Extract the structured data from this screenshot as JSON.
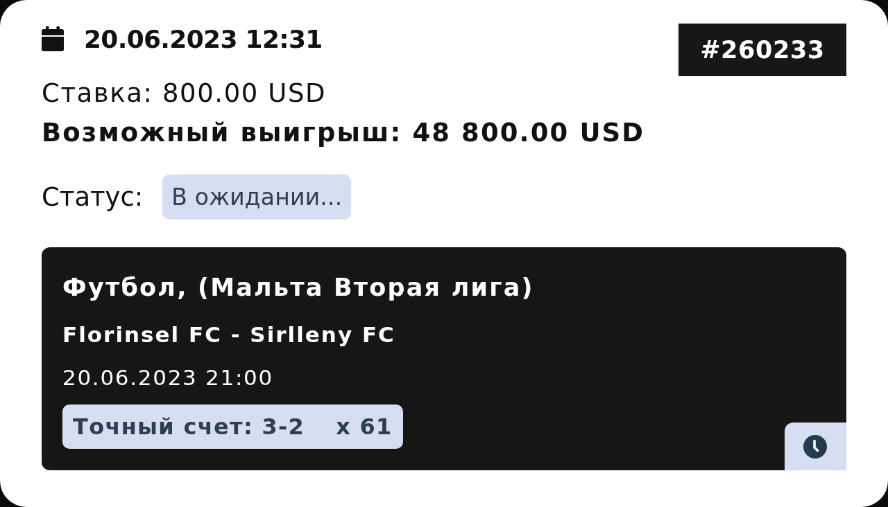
{
  "bet": {
    "datetime": "20.06.2023 12:31",
    "number": "#260233",
    "stake": "Ставка: 800.00 USD",
    "possible_win": "Возможный выигрыш: 48 800.00 USD",
    "status_label": "Статус:",
    "status": "В ожидании..."
  },
  "events": [
    {
      "title": "Футбол, (Мальта Вторая лига)",
      "match": "Florinsel FC - Sirlleny FC",
      "start_time": "20.06.2023 21:00",
      "outcome": "Точный счет: 3-2",
      "odds": "x 61",
      "pending": true
    }
  ]
}
